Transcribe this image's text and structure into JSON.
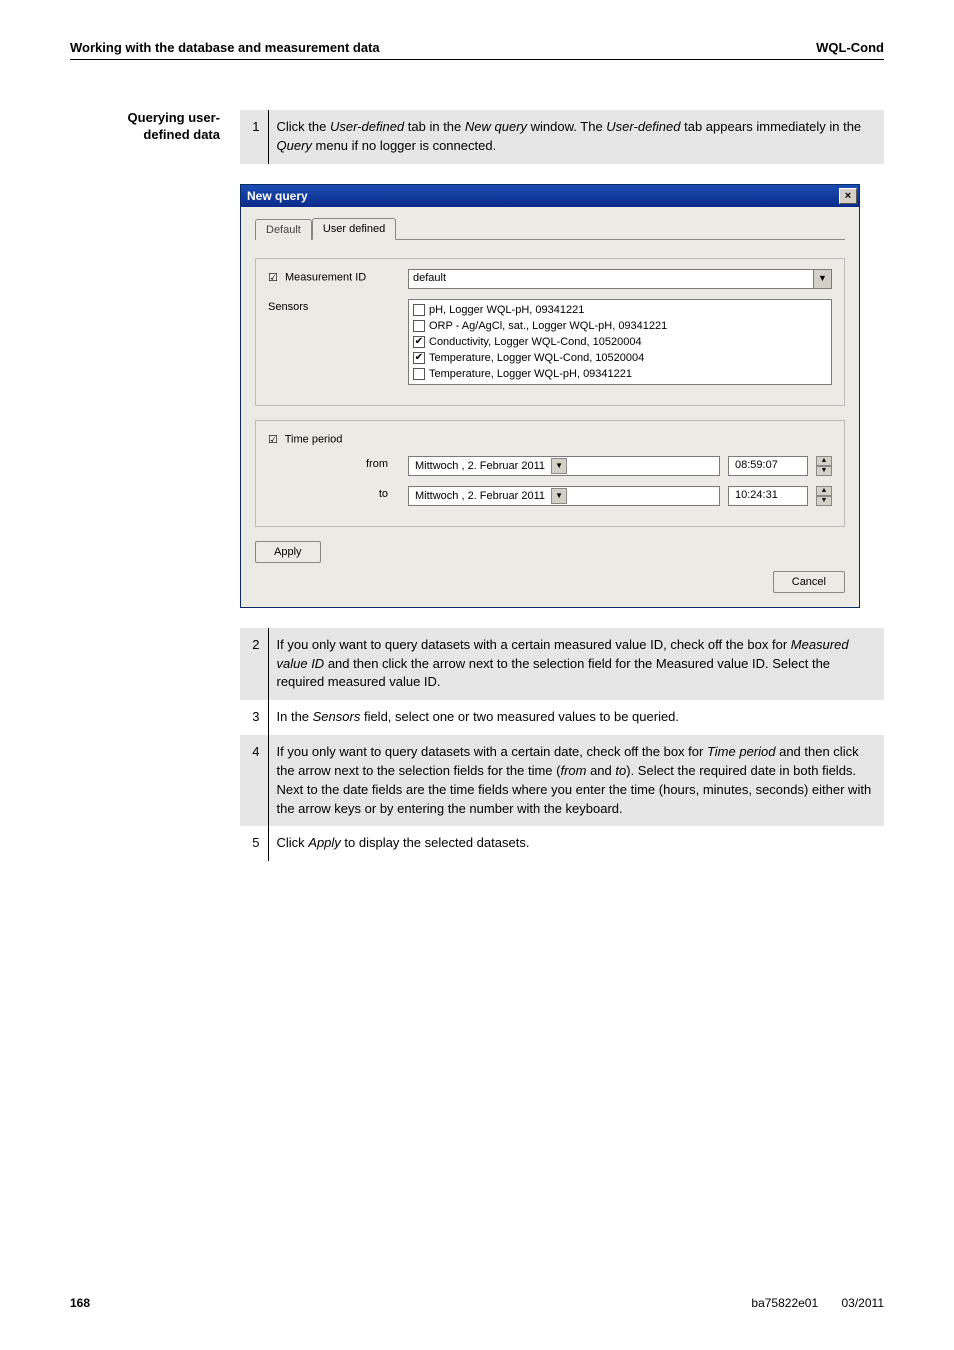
{
  "header": {
    "left": "Working with the database and measurement data",
    "right": "WQL-Cond"
  },
  "sideHeading": {
    "line1": "Querying user-",
    "line2": "defined data"
  },
  "step1": {
    "num": "1",
    "text_pre": "Click the ",
    "italic1": "User-defined",
    "text_mid1": " tab in the ",
    "italic2": "New query",
    "text_mid2": " window. The ",
    "italic3": "User-defined",
    "text_mid3": " tab appears immediately in the ",
    "italic4": "Query",
    "text_end": " menu if no logger is connected."
  },
  "dialog": {
    "title": "New query",
    "close": "×",
    "tabs": {
      "default": "Default",
      "user": "User defined"
    },
    "measurement_label": "Measurement ID",
    "measurement_value": "default",
    "sensors_label": "Sensors",
    "sensors": [
      {
        "checked": false,
        "label": "pH, Logger WQL-pH, 09341221"
      },
      {
        "checked": false,
        "label": "ORP - Ag/AgCl, sat., Logger WQL-pH, 09341221"
      },
      {
        "checked": true,
        "label": "Conductivity, Logger WQL-Cond, 10520004"
      },
      {
        "checked": true,
        "label": "Temperature, Logger WQL-Cond, 10520004"
      },
      {
        "checked": false,
        "label": "Temperature, Logger WQL-pH, 09341221"
      }
    ],
    "timeperiod_label": "Time period",
    "from_label": "from",
    "to_label": "to",
    "from_date": "Mittwoch ,  2.  Februar   2011",
    "from_time": "08:59:07",
    "to_date": "Mittwoch ,  2.  Februar   2011",
    "to_time": "10:24:31",
    "apply": "Apply",
    "cancel": "Cancel"
  },
  "steps": {
    "r2": {
      "num": "2",
      "pre": "If you only want to query datasets with a certain measured value ID, check off the box for ",
      "italic": "Measured value ID",
      "post": " and then click the arrow next to the selection field for the Measured value ID. Select the required measured value ID."
    },
    "r3": {
      "num": "3",
      "pre": "In the ",
      "italic": "Sensors",
      "post": " field, select one or two measured values to be queried."
    },
    "r4": {
      "num": "4",
      "pre": "If you only want to query datasets with a certain date, check off the box for ",
      "italic1": "Time period",
      "mid1": " and then click the arrow next to the selection fields for the time (",
      "italic2": "from",
      "mid2": " and ",
      "italic3": "to",
      "post": "). Select the required date in both fields. Next to the date fields are the time fields where you enter the time (hours, minutes, seconds) either with the arrow keys or by entering the number with the keyboard."
    },
    "r5": {
      "num": "5",
      "pre": "Click ",
      "italic": "Apply",
      "post": " to display the selected datasets."
    }
  },
  "footer": {
    "page": "168",
    "doc": "ba75822e01",
    "date": "03/2011"
  },
  "chart_data": {
    "type": "table",
    "note": "no chart; UI screenshot"
  }
}
